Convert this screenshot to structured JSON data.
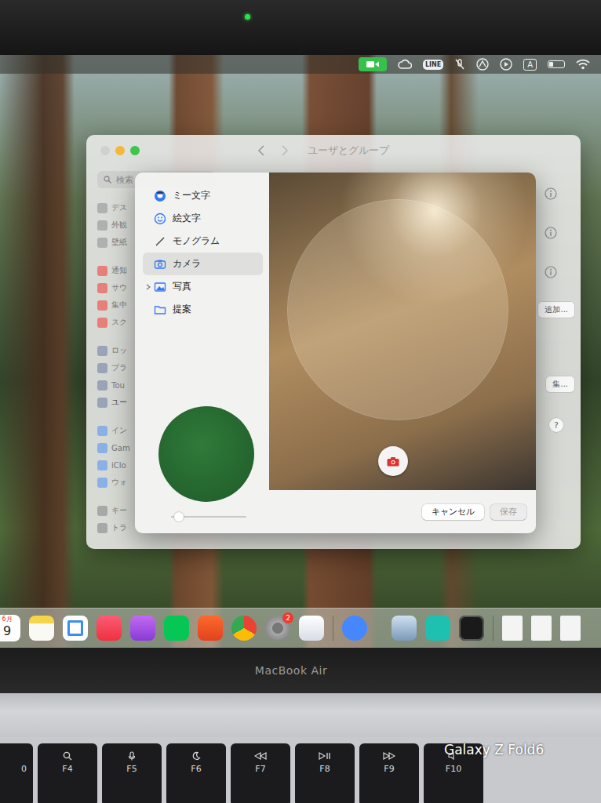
{
  "menu_bar": {
    "camera_active": true,
    "line_label": "LINE",
    "input_source": "A",
    "battery": {
      "level": 0.3
    }
  },
  "window": {
    "title": "ユーザとグループ",
    "search_placeholder": "検索",
    "sidebar_groups": [
      [
        {
          "label": "デス",
          "selected": false
        },
        {
          "label": "外観",
          "selected": false
        },
        {
          "label": "壁紙",
          "selected": false
        }
      ],
      [
        {
          "label": "通知",
          "selected": false
        },
        {
          "label": "サウ",
          "selected": false
        },
        {
          "label": "集中",
          "selected": false
        },
        {
          "label": "スク",
          "selected": false
        }
      ],
      [
        {
          "label": "ロッ",
          "selected": false
        },
        {
          "label": "プラ",
          "selected": false
        },
        {
          "label": "Tou",
          "selected": false
        },
        {
          "label": "ユー",
          "selected": true
        }
      ],
      [
        {
          "label": "イン",
          "selected": false
        },
        {
          "label": "Gam",
          "selected": false
        },
        {
          "label": "iClo",
          "selected": false
        },
        {
          "label": "ウォ",
          "selected": false
        }
      ],
      [
        {
          "label": "キー",
          "selected": false
        },
        {
          "label": "トラ",
          "selected": false
        }
      ]
    ],
    "actions": [
      {
        "label": "追加..."
      },
      {
        "label": "集..."
      }
    ],
    "help": "?"
  },
  "dialog": {
    "categories": [
      {
        "label": "ミー文字",
        "selected": false,
        "expandable": false
      },
      {
        "label": "絵文字",
        "selected": false,
        "expandable": false
      },
      {
        "label": "モノグラム",
        "selected": false,
        "expandable": false
      },
      {
        "label": "カメラ",
        "selected": true,
        "expandable": false
      },
      {
        "label": "写真",
        "selected": false,
        "expandable": true
      },
      {
        "label": "提案",
        "selected": false,
        "expandable": false
      }
    ],
    "zoom": {
      "level": 0.05
    },
    "buttons": [
      {
        "label": "キャンセル",
        "disabled": false
      },
      {
        "label": "保存",
        "disabled": true
      }
    ]
  },
  "dock": {
    "calendar": {
      "month": "6月",
      "day": "9"
    },
    "badge": "2"
  },
  "bezel": {
    "label": "MacBook Air"
  },
  "keyboard": {
    "keys": [
      "0",
      "F4",
      "F5",
      "F6",
      "F7",
      "F8",
      "F9",
      "F10"
    ]
  },
  "watermark": "Galaxy Z Fold6"
}
